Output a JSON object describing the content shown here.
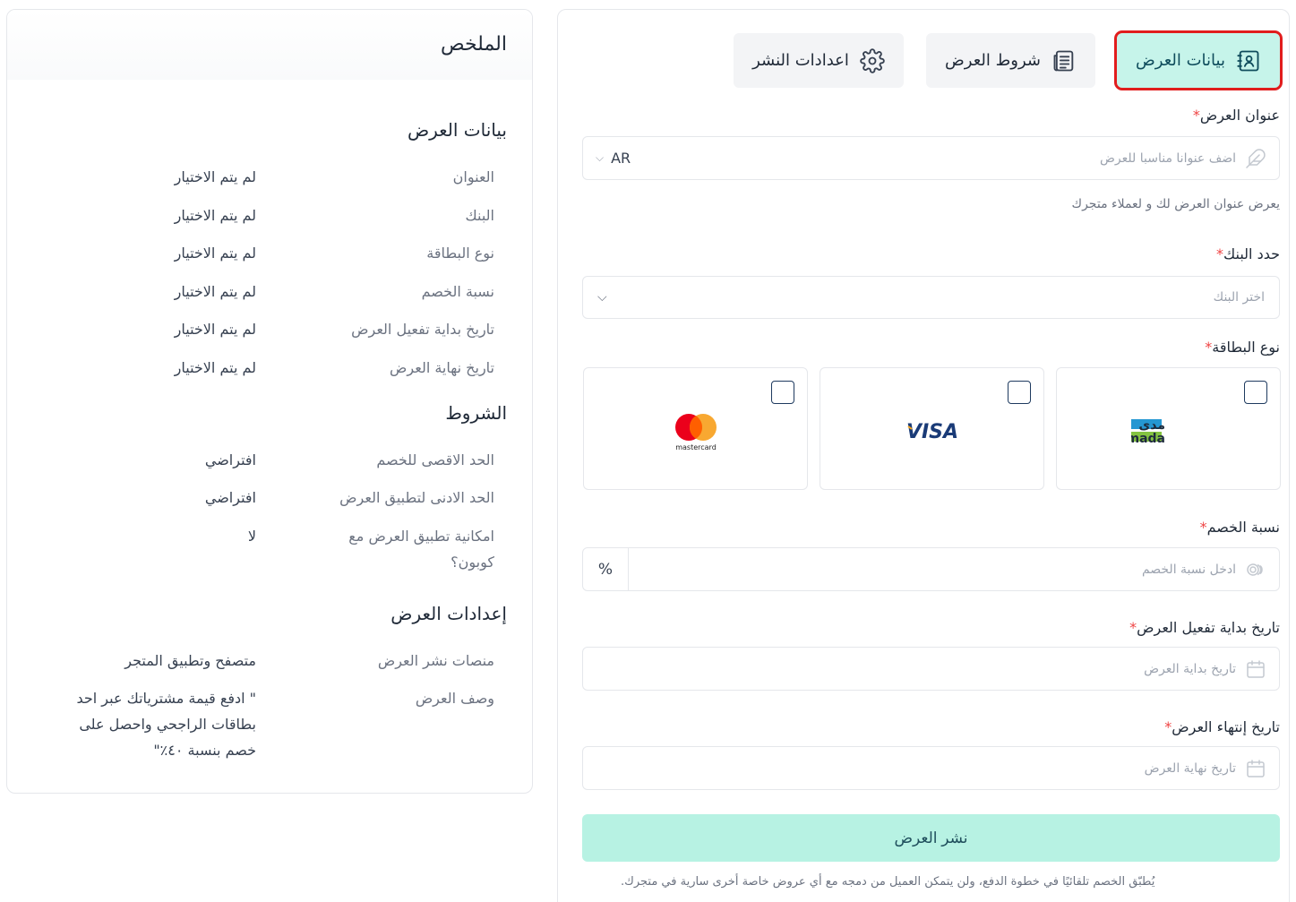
{
  "tabs": {
    "offer_data": "بيانات العرض",
    "offer_terms": "شروط العرض",
    "publish_settings": "اعدادات النشر"
  },
  "form": {
    "title_label": "عنوان العرض",
    "title_placeholder": "اضف عنوانا مناسبا للعرض",
    "language": "AR",
    "title_hint": "يعرض عنوان العرض لك و لعملاء متجرك",
    "bank_label": "حدد البنك",
    "bank_placeholder": "اختر البنك",
    "card_type_label": "نوع البطاقة",
    "cards": [
      "mada",
      "VISA",
      "mastercard"
    ],
    "mada_ar": "مدى",
    "discount_label": "نسبة الخصم",
    "discount_placeholder": "ادخل نسبة الخصم",
    "discount_unit": "%",
    "start_label": "تاريخ بداية تفعيل العرض",
    "start_placeholder": "تاريخ بداية العرض",
    "end_label": "تاريخ إنتهاء العرض",
    "end_placeholder": "تاريخ نهاية العرض",
    "required_mark": "*",
    "publish_button": "نشر العرض",
    "note": "يُطبّق الخصم تلقائيًا في خطوة الدفع، ولن يتمكن العميل من دمجه مع أي عروض خاصة أخرى سارية في متجرك."
  },
  "summary": {
    "title": "الملخص",
    "offer_section": "بيانات العرض",
    "offer_rows": [
      {
        "label": "العنوان",
        "value": "لم يتم الاختيار"
      },
      {
        "label": "البنك",
        "value": "لم يتم الاختيار"
      },
      {
        "label": "نوع البطاقة",
        "value": "لم يتم الاختيار"
      },
      {
        "label": "نسبة الخصم",
        "value": "لم يتم الاختيار"
      },
      {
        "label": "تاريخ بداية تفعيل العرض",
        "value": "لم يتم الاختيار"
      },
      {
        "label": "تاريخ نهاية العرض",
        "value": "لم يتم الاختيار"
      }
    ],
    "terms_section": "الشروط",
    "terms_rows": [
      {
        "label": "الحد الاقصى للخصم",
        "value": "افتراضي"
      },
      {
        "label": "الحد الادنى لتطبيق العرض",
        "value": "افتراضي"
      },
      {
        "label": "امكانية تطبيق العرض مع كوبون؟",
        "value": "لا"
      }
    ],
    "settings_section": "إعدادات العرض",
    "settings_rows": [
      {
        "label": "منصات نشر العرض",
        "value": "متصفح وتطبيق المتجر"
      },
      {
        "label": "وصف العرض",
        "value": "\" ادفع قيمة مشترياتك عبر احد بطاقات الراجحي واحصل على خصم بنسبة ٤٠٪\""
      }
    ]
  },
  "colors": {
    "active_tab_bg": "#c6f4ea",
    "active_tab_outline": "#e11d1d",
    "publish_bg": "#b7f2e3",
    "required": "#ef4444"
  }
}
